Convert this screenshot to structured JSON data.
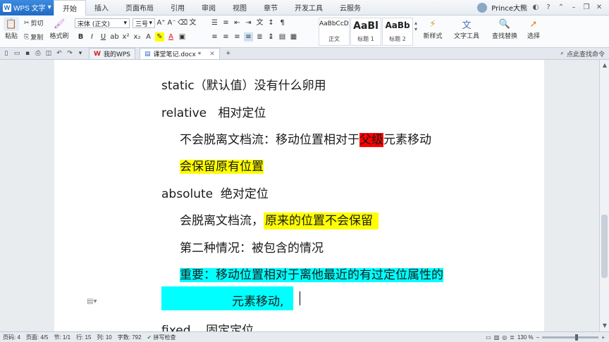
{
  "app": {
    "name": "WPS 文字"
  },
  "menu": [
    "开始",
    "插入",
    "页面布局",
    "引用",
    "审阅",
    "视图",
    "章节",
    "开发工具",
    "云服务"
  ],
  "user": {
    "name": "Prince大熊"
  },
  "ribbon": {
    "paste": "粘贴",
    "cut": "剪切",
    "copy": "复制",
    "format_painter": "格式刷",
    "font": "宋体 (正文)",
    "size": "三号",
    "styles": [
      {
        "sample": "AaBbCcDd",
        "label": "正文"
      },
      {
        "sample": "AaBl",
        "label": "标题 1"
      },
      {
        "sample": "AaBb",
        "label": "标题 2"
      }
    ],
    "new_style": "新样式",
    "text_tools": "文字工具",
    "find_replace": "查找替换",
    "select": "选择"
  },
  "tabs": {
    "my_wps": "我的WPS",
    "doc": "课堂笔记.docx *",
    "right": "点此查找命令"
  },
  "document": {
    "l1": "static（默认值）没有什么卵用",
    "l2a": "relative",
    "l2b": "相对定位",
    "l3a": "不会脱离文档流：移动位置相对于",
    "l3b": "父级",
    "l3c": "元素移动",
    "l4": "会保留原有位置",
    "l5a": "absolute",
    "l5b": "绝对定位",
    "l6a": "会脱离文档流，",
    "l6b": "原来的位置不会保留",
    "l7": "第二种情况：被包含的情况",
    "l8": "重要：移动位置相对于离他最近的有过定位属性的",
    "l9": "元素移动,",
    "l10a": "fixed",
    "l10b": "固定定位"
  },
  "status": {
    "page": "页码: 4",
    "pages": "页面: 4/5",
    "section": "节: 1/1",
    "line": "行: 15",
    "col": "列: 10",
    "words": "字数: 792",
    "spell": "拼写检查",
    "zoom": "130 %",
    "zoom_level": 0.62
  },
  "colors": {
    "highlight_yellow": "#ffff00",
    "highlight_red": "#ff0000",
    "highlight_cyan": "#00ffff",
    "app_blue": "#1f6bc4"
  }
}
